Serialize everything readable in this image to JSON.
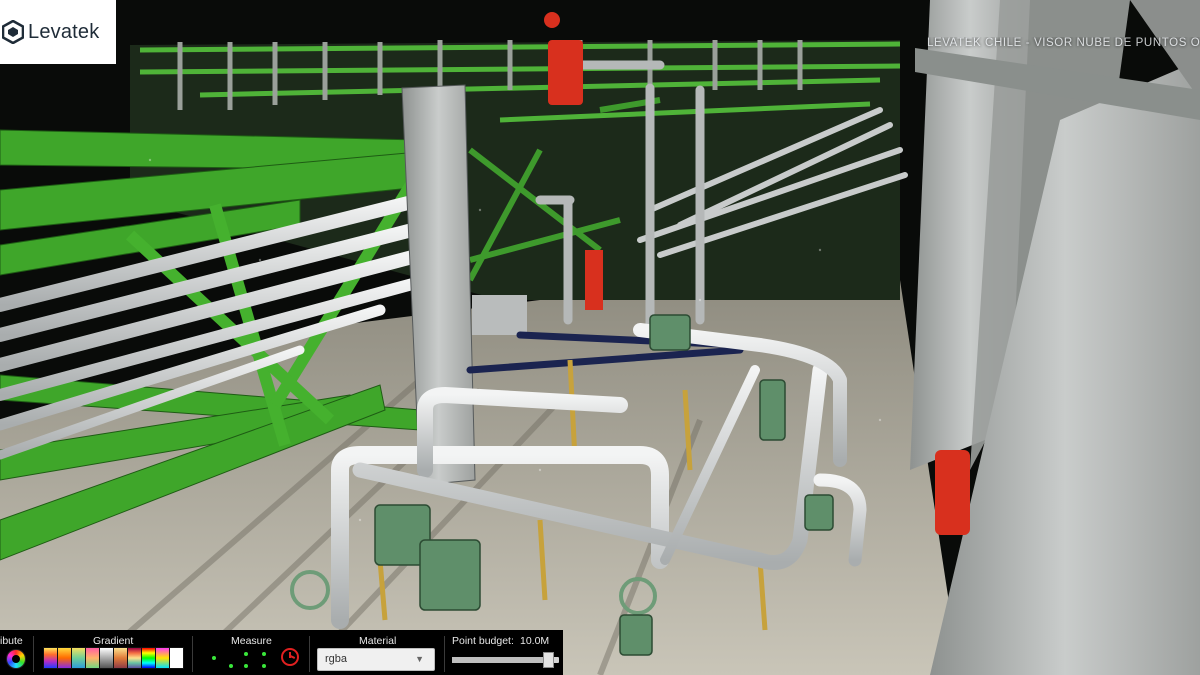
{
  "header": {
    "logo_text": "Levatek",
    "viewer_title": "LEVATEK CHILE - VISOR NUBE DE PUNTOS O"
  },
  "toolbar": {
    "attribute_label": "ibute",
    "gradient_label": "Gradient",
    "gradient_swatches": [
      "rainbow-1",
      "rainbow-2",
      "rainbow-3",
      "rainbow-4",
      "grayscale",
      "rainbow-5",
      "spectral",
      "rainbow-6",
      "rainbow-7",
      "white"
    ],
    "measure_label": "Measure",
    "material_label": "Material",
    "material_value": "rgba",
    "point_budget_label": "Point budget:",
    "point_budget_value": "10.0M",
    "point_budget_level": 0.95
  },
  "colors": {
    "steel_green": "#3fa62a",
    "pipe_white": "#d9dcdc",
    "valve_red": "#d8301e",
    "toolbar_bg": "#000000"
  }
}
